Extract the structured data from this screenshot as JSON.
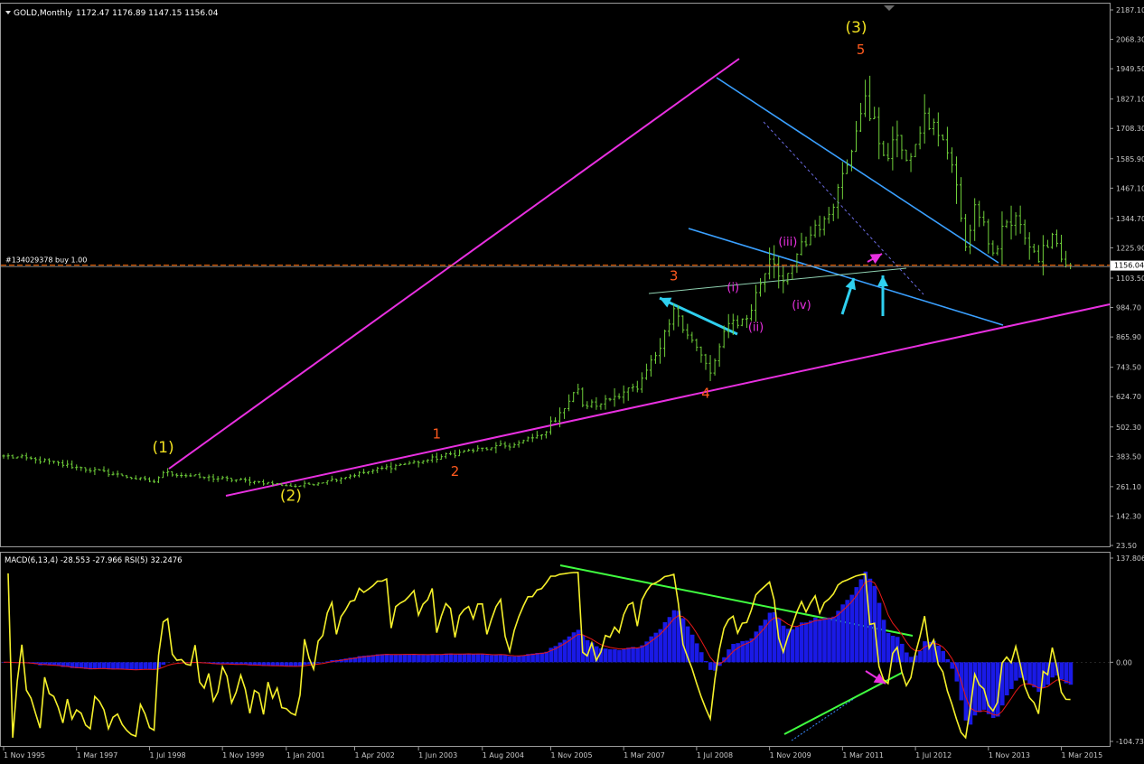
{
  "header": {
    "symbol": "GOLD,Monthly",
    "ohlc": "1172.47 1176.89 1147.15 1156.04"
  },
  "order_line": {
    "label": "#134029378 buy 1.00",
    "price": 1156.04,
    "price_label": "1156.04"
  },
  "indicator_header": "MACD(6,13,4) -28.553 -27.966 RSI(5) 32.2476",
  "colors": {
    "background": "#000000",
    "price_bars": "#6fcf3a",
    "magenta": "#e830e0",
    "cyan": "#2fd0f0",
    "blue_line": "#3aa0ff",
    "wave_yellow": "#f0e020",
    "wave_orange": "#ff5a1e",
    "rsi": "#f5f02a",
    "macd_hist": "#1a1ae6",
    "signal": "#e81818",
    "green_trend": "#40ff40",
    "grid_text": "#c8c8c8"
  },
  "chart_data": [
    {
      "type": "line",
      "series_kind": "ohlc-bars",
      "title": "GOLD,Monthly",
      "ylim": [
        23.5,
        2187.1
      ],
      "y_ticks": [
        "2187.10",
        "2068.30",
        "1949.50",
        "1827.10",
        "1708.30",
        "1585.90",
        "1467.10",
        "1344.70",
        "1225.90",
        "1103.50",
        "984.70",
        "865.90",
        "743.50",
        "624.70",
        "502.30",
        "383.50",
        "261.10",
        "142.30",
        "23.50"
      ],
      "x_start": "1 Nov 1995",
      "x_end": "1 May 2015",
      "anchors": [
        [
          "1995-11",
          385
        ],
        [
          "1996-06",
          370
        ],
        [
          "1997-03",
          340
        ],
        [
          "1998-01",
          305
        ],
        [
          "1998-08",
          280
        ],
        [
          "1998-10",
          318
        ],
        [
          "1999-06",
          300
        ],
        [
          "2000-06",
          282
        ],
        [
          "2001-03",
          262
        ],
        [
          "2001-10",
          285
        ],
        [
          "2002-06",
          318
        ],
        [
          "2003-02",
          350
        ],
        [
          "2003-08",
          368
        ],
        [
          "2004-03",
          400
        ],
        [
          "2004-10",
          418
        ],
        [
          "2005-03",
          430
        ],
        [
          "2005-09",
          470
        ],
        [
          "2006-01",
          560
        ],
        [
          "2006-05",
          655
        ],
        [
          "2006-06",
          590
        ],
        [
          "2006-10",
          595
        ],
        [
          "2007-04",
          660
        ],
        [
          "2007-06",
          655
        ],
        [
          "2007-11",
          820
        ],
        [
          "2008-02",
          980
        ],
        [
          "2008-03",
          950
        ],
        [
          "2008-10",
          720
        ],
        [
          "2009-02",
          920
        ],
        [
          "2009-06",
          940
        ],
        [
          "2009-11",
          1180
        ],
        [
          "2010-02",
          1090
        ],
        [
          "2010-06",
          1250
        ],
        [
          "2010-10",
          1300
        ],
        [
          "2011-01",
          1390
        ],
        [
          "2011-04",
          1560
        ],
        [
          "2011-08",
          1840
        ],
        [
          "2011-12",
          1600
        ],
        [
          "2012-03",
          1680
        ],
        [
          "2012-05",
          1580
        ],
        [
          "2012-09",
          1770
        ],
        [
          "2012-12",
          1680
        ],
        [
          "2013-02",
          1610
        ],
        [
          "2013-04",
          1480
        ],
        [
          "2013-06",
          1230
        ],
        [
          "2013-08",
          1400
        ],
        [
          "2013-12",
          1205
        ],
        [
          "2014-03",
          1330
        ],
        [
          "2014-06",
          1320
        ],
        [
          "2014-10",
          1170
        ],
        [
          "2015-01",
          1280
        ],
        [
          "2015-03",
          1180
        ],
        [
          "2015-05",
          1156
        ]
      ],
      "wave_labels": [
        {
          "text": "(1)",
          "date": "1998-10",
          "price": 400,
          "color": "yellow"
        },
        {
          "text": "(2)",
          "date": "2001-02",
          "price": 205,
          "color": "yellow"
        },
        {
          "text": "(3)",
          "date": "2011-06",
          "price": 2095,
          "color": "yellow"
        },
        {
          "text": "1",
          "date": "2003-10",
          "price": 455,
          "color": "orange"
        },
        {
          "text": "2",
          "date": "2004-02",
          "price": 305,
          "color": "orange"
        },
        {
          "text": "3",
          "date": "2008-02",
          "price": 1095,
          "color": "orange"
        },
        {
          "text": "4",
          "date": "2008-09",
          "price": 620,
          "color": "orange"
        },
        {
          "text": "5",
          "date": "2011-07",
          "price": 2008,
          "color": "orange"
        },
        {
          "text": "(i)",
          "date": "2009-03",
          "price": 1050,
          "color": "magenta"
        },
        {
          "text": "(ii)",
          "date": "2009-08",
          "price": 890,
          "color": "magenta"
        },
        {
          "text": "(iii)",
          "date": "2010-03",
          "price": 1235,
          "color": "magenta"
        },
        {
          "text": "(iv)",
          "date": "2010-06",
          "price": 980,
          "color": "magenta"
        }
      ]
    },
    {
      "type": "line",
      "series_kind": "macd-rsi",
      "title": "MACD(6,13,4) -28.553 -27.966 RSI(5) 32.2476",
      "ylim": [
        -104.732,
        137.806
      ],
      "y_ticks": [
        "137.806",
        "0.00",
        "-104.732"
      ],
      "x_ticks": [
        "1 Nov 1995",
        "1 Mar 1997",
        "1 Jul 1998",
        "1 Nov 1999",
        "1 Jan 2001",
        "1 Apr 2002",
        "1 Jun 2003",
        "1 Aug 2004",
        "1 Nov 2005",
        "1 Mar 2007",
        "1 Jul 2008",
        "1 Nov 2009",
        "1 Mar 2011",
        "1 Jul 2012",
        "1 Nov 2013",
        "1 Mar 2015"
      ],
      "series": [
        {
          "kind": "histogram",
          "color": "#1a1ae6"
        },
        {
          "kind": "signal",
          "color": "#e81818"
        },
        {
          "kind": "rsi",
          "color": "#f5f02a"
        }
      ]
    }
  ]
}
